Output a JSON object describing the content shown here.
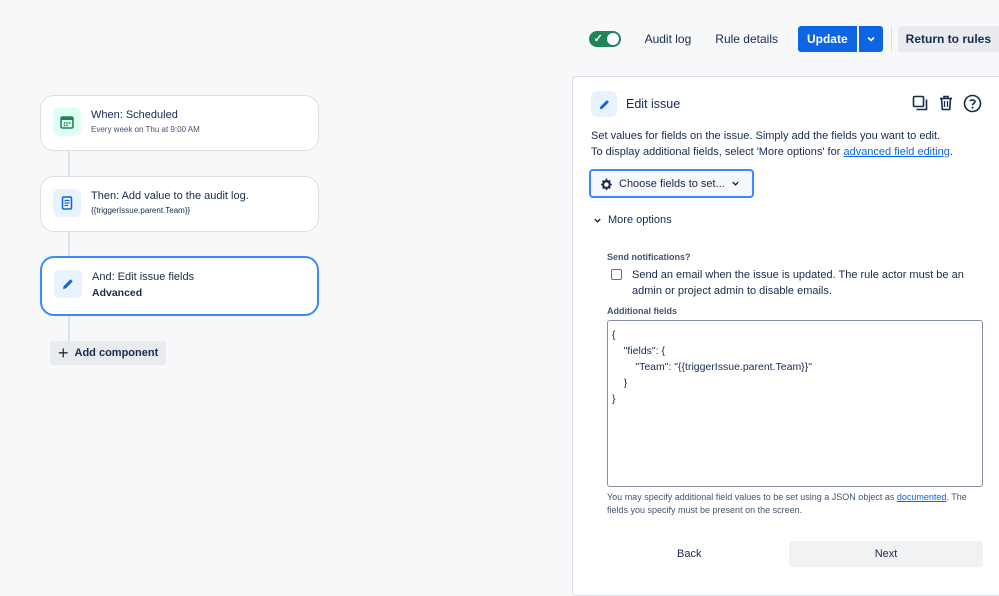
{
  "topbar": {
    "toggle_state": "on",
    "audit_log": "Audit log",
    "rule_details": "Rule details",
    "update": "Update",
    "return_to_rules": "Return to rules"
  },
  "flow": {
    "trigger": {
      "title": "When: Scheduled",
      "subtitle": "Every week on Thu at 9:00 AM",
      "icon": "calendar-icon"
    },
    "action1": {
      "title": "Then: Add value to the audit log.",
      "subtitle": "{{triggerIssue.parent.Team}}",
      "icon": "document-icon"
    },
    "action2": {
      "title": "And: Edit issue fields",
      "subtitle": "Advanced",
      "icon": "pencil-icon"
    },
    "add_component": "Add component"
  },
  "panel": {
    "title": "Edit issue",
    "desc_line1": "Set values for fields on the issue. Simply add the fields you want to edit.",
    "desc_line2_prefix": "To display additional fields, select 'More options' for ",
    "desc_link": "advanced field editing",
    "desc_line2_suffix": ".",
    "choose_fields": "Choose fields to set...",
    "more_options": "More options",
    "send_notifications_label": "Send notifications?",
    "send_email_text": "Send an email when the issue is updated. The rule actor must be an admin or project admin to disable emails.",
    "additional_fields_label": "Additional fields",
    "additional_fields_value": "{\n    \"fields\": {\n        \"Team\": \"{{triggerIssue.parent.Team}}\"\n    }\n}",
    "help_prefix": "You may specify additional field values to be set using a JSON object as ",
    "help_link": "documented",
    "help_suffix": ". The fields you specify must be present on the screen.",
    "back": "Back",
    "next": "Next"
  },
  "colors": {
    "primary": "#0c66e4",
    "toggle_on": "#1f845a",
    "selected_border": "#388bff"
  }
}
